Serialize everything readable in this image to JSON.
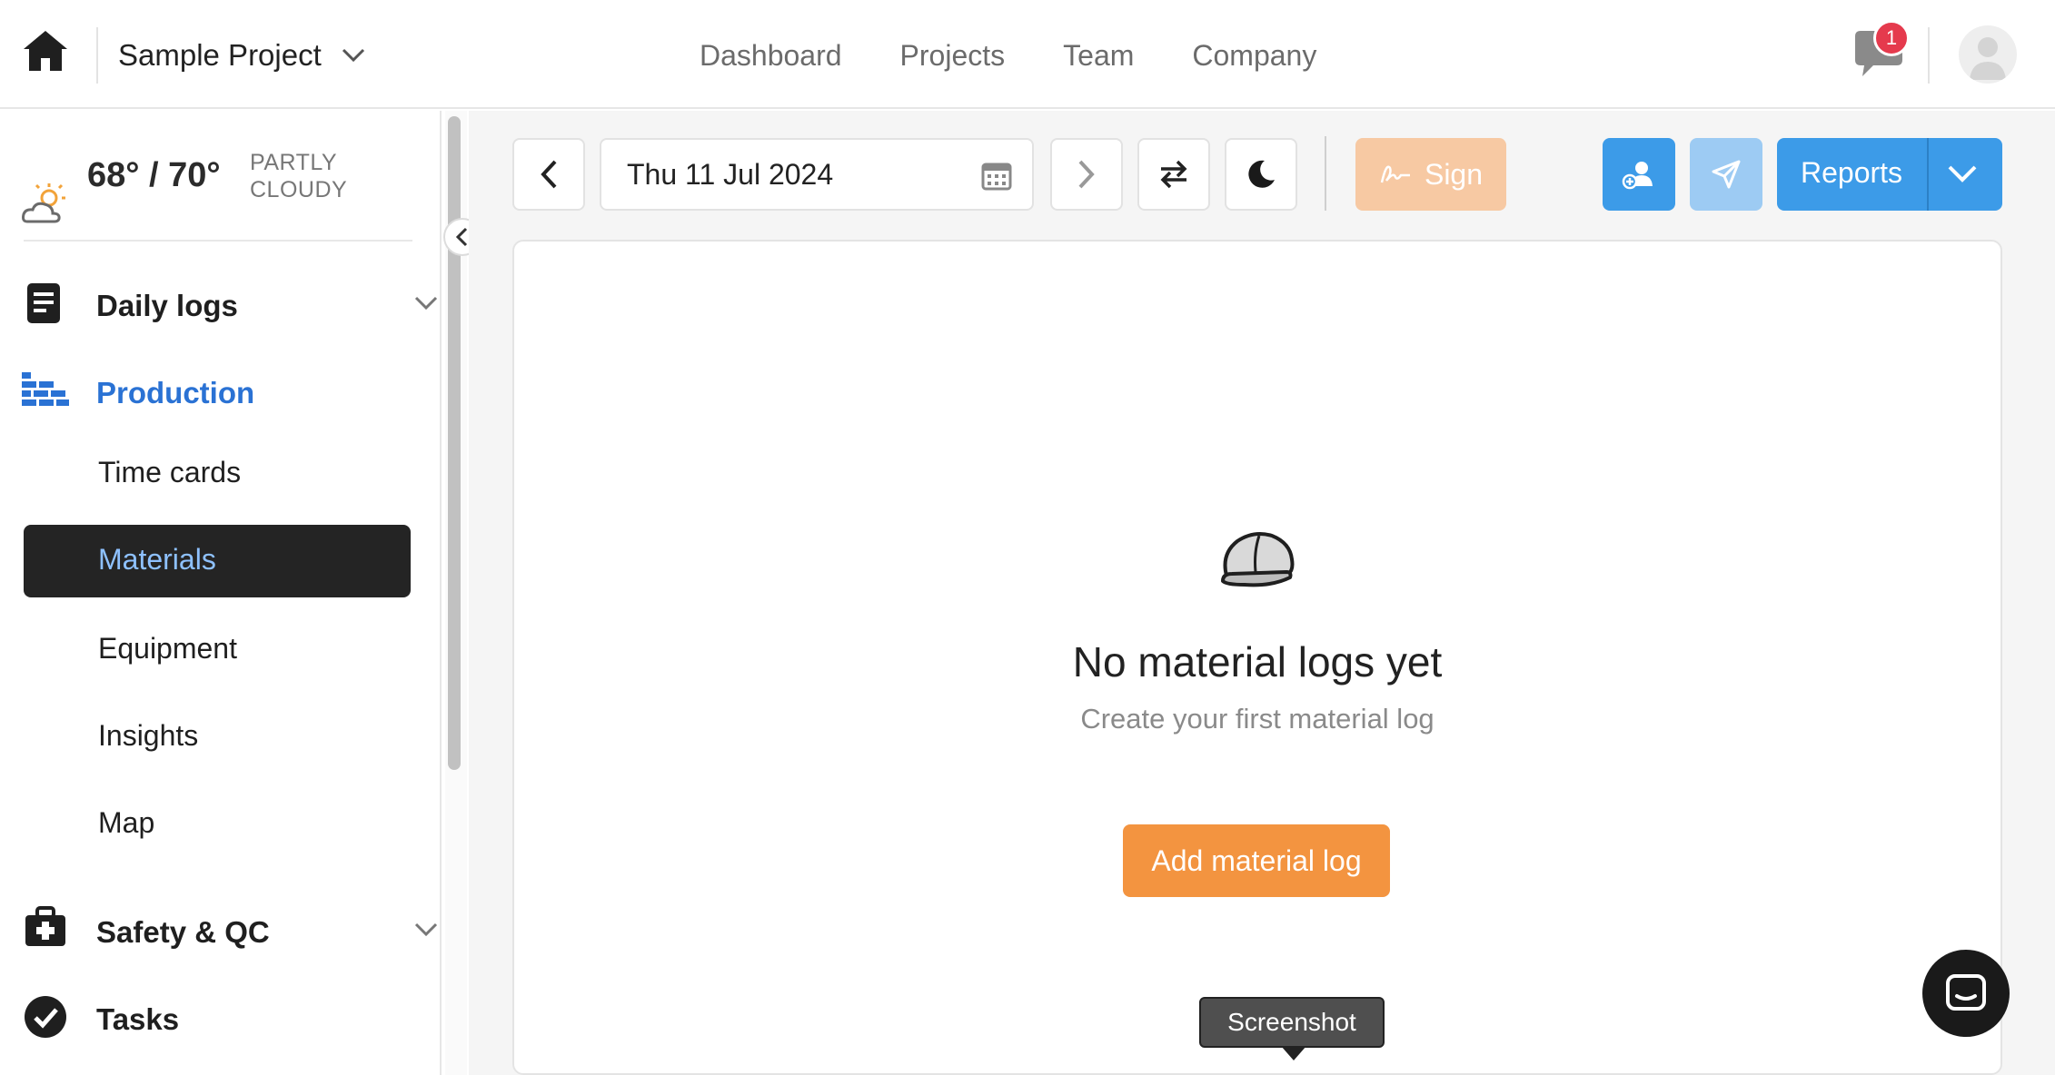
{
  "header": {
    "project_name": "Sample Project",
    "nav": [
      "Dashboard",
      "Projects",
      "Team",
      "Company"
    ],
    "notification_count": "1"
  },
  "sidebar": {
    "weather": {
      "temp": "68° / 70°",
      "condition": "PARTLY CLOUDY"
    },
    "sections": {
      "daily_logs": "Daily logs",
      "production": "Production",
      "safety": "Safety & QC",
      "tasks": "Tasks"
    },
    "production_items": [
      "Time cards",
      "Materials",
      "Equipment",
      "Insights",
      "Map"
    ],
    "active_item": "Materials"
  },
  "toolbar": {
    "date": "Thu 11 Jul 2024",
    "sign_label": "Sign",
    "reports_label": "Reports"
  },
  "empty_state": {
    "title": "No material logs yet",
    "subtitle": "Create your first material log",
    "button": "Add material log"
  },
  "tooltip": "Screenshot",
  "colors": {
    "accent_blue": "#3c9be8",
    "production_blue": "#2a72d4",
    "orange": "#f39440",
    "sign_disabled": "#f7c9a3",
    "badge_red": "#e53a4d"
  }
}
